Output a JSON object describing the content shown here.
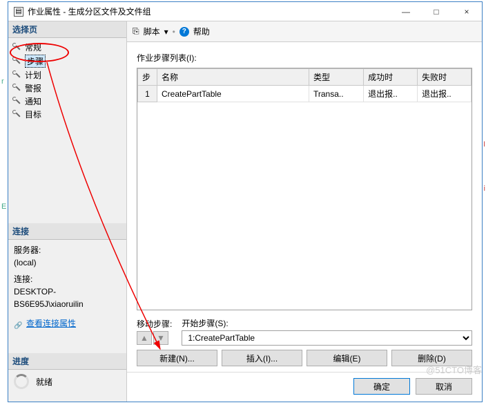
{
  "window": {
    "title": "作业属性 - 生成分区文件及文件组",
    "minimize": "—",
    "maximize": "□",
    "close": "×"
  },
  "left": {
    "select_page": "选择页",
    "nav": [
      {
        "label": "常规"
      },
      {
        "label": "步骤",
        "selected": true
      },
      {
        "label": "计划"
      },
      {
        "label": "警报"
      },
      {
        "label": "通知"
      },
      {
        "label": "目标"
      }
    ],
    "connection_hdr": "连接",
    "server_label": "服务器:",
    "server_value": "(local)",
    "conn_label": "连接:",
    "conn_value": "DESKTOP-BS6E95J\\xiaoruilin",
    "view_conn": "查看连接属性",
    "progress_hdr": "进度",
    "progress_value": "就绪"
  },
  "toolbar": {
    "script": "脚本",
    "dropdown": "▾",
    "help": "帮助"
  },
  "main": {
    "list_label": "作业步骤列表(I):",
    "columns": {
      "step": "步",
      "name": "名称",
      "type": "类型",
      "on_success": "成功时",
      "on_fail": "失败时"
    },
    "rows": [
      {
        "step": "1",
        "name": "CreatePartTable",
        "type": "Transa..",
        "on_success": "退出报..",
        "on_fail": "退出报.."
      }
    ],
    "move_label": "移动步骤:",
    "start_label": "开始步骤(S):",
    "start_value": "1:CreatePartTable",
    "buttons": {
      "new": "新建(N)...",
      "insert": "插入(I)...",
      "edit": "编辑(E)",
      "delete": "删除(D)"
    }
  },
  "dialog": {
    "ok": "确定",
    "cancel": "取消"
  },
  "watermark": "@51CTO博客",
  "edge": {
    "r": "r",
    "E": "E",
    "I": "I",
    "i": "i"
  }
}
